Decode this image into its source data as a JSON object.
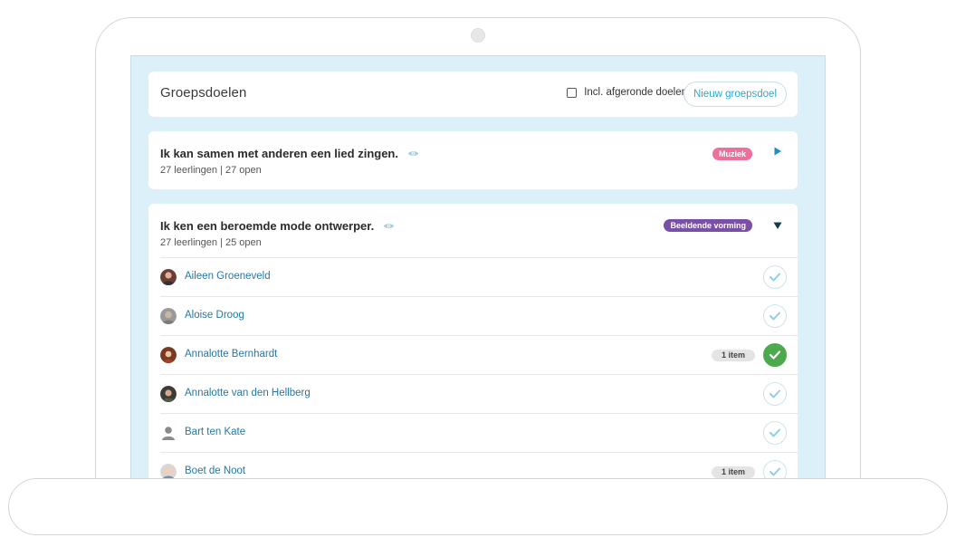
{
  "header": {
    "title": "Groepsdoelen",
    "include_label": "Incl. afgeronde doelen",
    "include_checked": false,
    "new_button": "Nieuw groepsdoel"
  },
  "colors": {
    "accent": "#2fa7cf",
    "link": "#2677a6",
    "screen_bg": "#dbf0f8",
    "tag_muziek": "#ee6f9c",
    "tag_beeldende": "#7a50a6",
    "done": "#4caa4c"
  },
  "goals": [
    {
      "title": "Ik kan samen met anderen een lied zingen.",
      "meta": "27 leerlingen | 27 open",
      "tag": "Muziek",
      "expanded": false,
      "icon": "eye-icon"
    },
    {
      "title": "Ik ken een beroemde mode ontwerper.",
      "meta": "27 leerlingen | 25 open",
      "tag": "Beeldende vorming",
      "expanded": true,
      "icon": "eye-icon",
      "students": [
        {
          "name": "Aileen Groeneveld",
          "badge": "",
          "done": false,
          "avatar": "photo-avatar"
        },
        {
          "name": "Aloise Droog",
          "badge": "",
          "done": false,
          "avatar": "photo-avatar"
        },
        {
          "name": "Annalotte Bernhardt",
          "badge": "1 item",
          "done": true,
          "avatar": "photo-avatar"
        },
        {
          "name": "Annalotte van den Hellberg",
          "badge": "",
          "done": false,
          "avatar": "photo-avatar"
        },
        {
          "name": "Bart ten Kate",
          "badge": "",
          "done": false,
          "avatar": "person-icon"
        },
        {
          "name": "Boet de Noot",
          "badge": "1 item",
          "done": false,
          "avatar": "photo-avatar"
        }
      ]
    }
  ]
}
